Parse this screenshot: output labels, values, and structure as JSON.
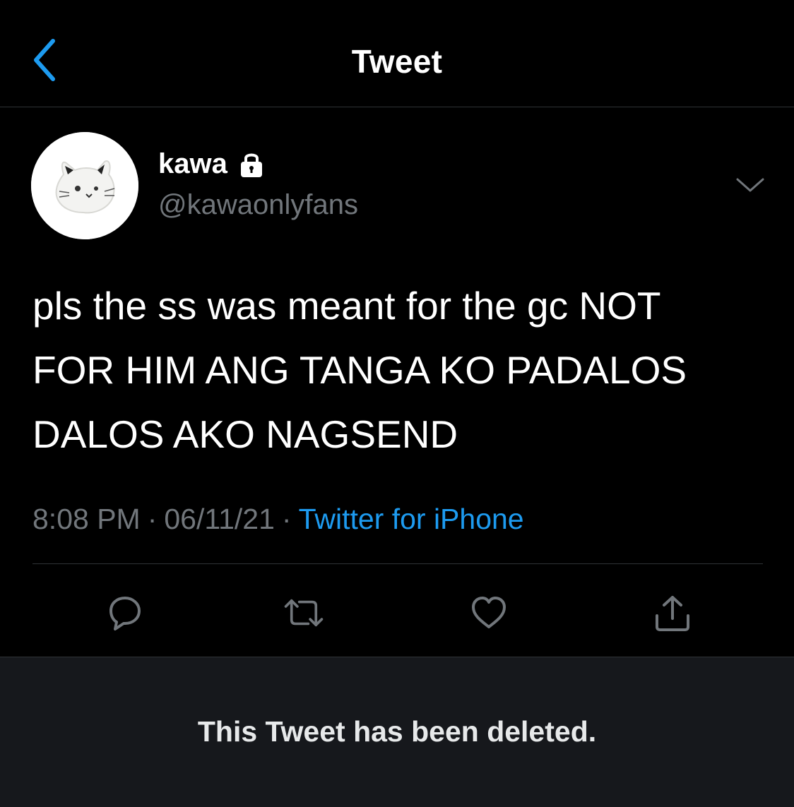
{
  "header": {
    "title": "Tweet",
    "back_icon": "chevron-left-icon"
  },
  "author": {
    "display_name": "kawa",
    "handle": "@kawaonlyfans",
    "protected_icon": "lock-icon",
    "avatar": "cat-plush-avatar"
  },
  "tweet": {
    "text_line1": "pls the ss was meant for the gc NOT",
    "text_line2": "FOR HIM ANG TANGA KO PADALOS",
    "text_line3": "DALOS AKO NAGSEND",
    "time": "8:08 PM",
    "separator": "·",
    "date": "06/11/21",
    "source": "Twitter for iPhone"
  },
  "actions": {
    "reply_icon": "reply-icon",
    "retweet_icon": "retweet-icon",
    "like_icon": "heart-icon",
    "share_icon": "share-icon"
  },
  "notice": {
    "deleted_text": "This Tweet has been deleted."
  },
  "colors": {
    "accent": "#1d9bf0",
    "background": "#000000",
    "secondary_text": "#71767b",
    "notice_background": "#16181c"
  }
}
